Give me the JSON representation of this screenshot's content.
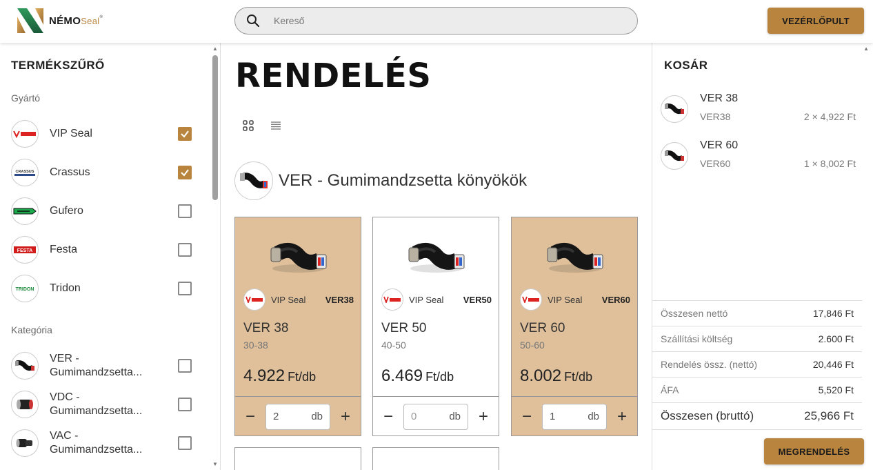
{
  "header": {
    "logo_text": "NÉMO",
    "logo_seal": "Seal",
    "logo_tm": "®",
    "search_placeholder": "Kereső",
    "dashboard_label": "VEZÉRLŐPULT"
  },
  "sidebar": {
    "title": "TERMÉKSZŰRŐ",
    "manufacturer_label": "Gyártó",
    "manufacturers": [
      {
        "label": "VIP Seal",
        "checked": true
      },
      {
        "label": "Crassus",
        "checked": true
      },
      {
        "label": "Gufero",
        "checked": false
      },
      {
        "label": "Festa",
        "checked": false
      },
      {
        "label": "Tridon",
        "checked": false
      }
    ],
    "category_label": "Kategória",
    "categories": [
      {
        "line1": "VER -",
        "line2": "Gumimandzsetta...",
        "checked": false
      },
      {
        "line1": "VDC -",
        "line2": "Gumimandzsetta...",
        "checked": false
      },
      {
        "line1": "VAC -",
        "line2": "Gumimandzsetta...",
        "checked": false
      }
    ],
    "logo_texts": {
      "vip": "VIP Seal",
      "crassus": "CRASSUS",
      "festa": "FESTA",
      "tridon": "TRIDON"
    }
  },
  "main": {
    "title": "RENDELÉS",
    "category_title": "VER - Gumimandzsetta könyökök",
    "products": [
      {
        "brand": "VIP Seal",
        "code": "VER38",
        "name": "VER 38",
        "range": "30-38",
        "price": "4.922",
        "unit": "Ft/db",
        "qty": "2",
        "qty_unit": "db",
        "selected": true
      },
      {
        "brand": "VIP Seal",
        "code": "VER50",
        "name": "VER 50",
        "range": "40-50",
        "price": "6.469",
        "unit": "Ft/db",
        "qty": "0",
        "qty_unit": "db",
        "selected": false
      },
      {
        "brand": "VIP Seal",
        "code": "VER60",
        "name": "VER 60",
        "range": "50-60",
        "price": "8.002",
        "unit": "Ft/db",
        "qty": "1",
        "qty_unit": "db",
        "selected": true
      }
    ]
  },
  "cart": {
    "title": "KOSÁR",
    "items": [
      {
        "name": "VER 38",
        "code": "VER38",
        "qty": "2 × 4,922 Ft"
      },
      {
        "name": "VER 60",
        "code": "VER60",
        "qty": "1 × 8,002 Ft"
      }
    ],
    "totals": [
      {
        "label": "Összesen nettó",
        "value": "17,846 Ft"
      },
      {
        "label": "Szállítási költség",
        "value": "2.600 Ft"
      },
      {
        "label": "Rendelés össz. (nettó)",
        "value": "20,446 Ft"
      },
      {
        "label": "ÁFA",
        "value": "5,520 Ft"
      }
    ],
    "grand_total_label": "Összesen (bruttó)",
    "grand_total_value": "25,966 Ft",
    "order_label": "MEGRENDELÉS"
  },
  "colors": {
    "accent": "#b8843e",
    "selected_card": "#dfc09b"
  }
}
